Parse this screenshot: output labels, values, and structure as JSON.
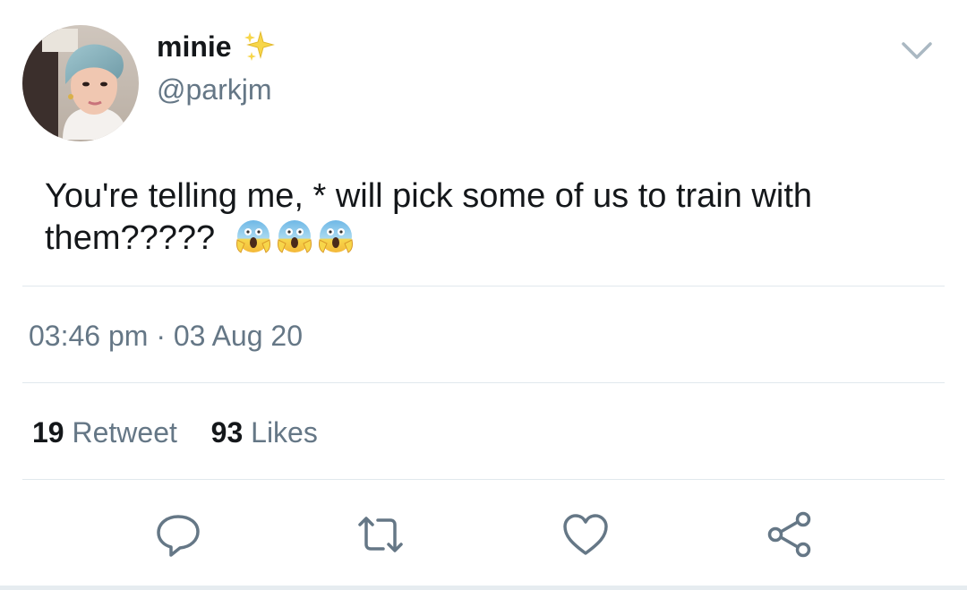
{
  "author": {
    "display_name": "minie",
    "handle": "@parkjm",
    "name_badge_icon": "sparkles-icon"
  },
  "tweet": {
    "text": "You're telling me, * will pick some of us to train with them?????",
    "emojis": [
      "face-screaming-in-fear-emoji",
      "face-screaming-in-fear-emoji",
      "face-screaming-in-fear-emoji"
    ]
  },
  "meta": {
    "time": "03:46 pm",
    "separator": "·",
    "date": "03 Aug 20"
  },
  "stats": {
    "retweet_count": "19",
    "retweet_label": "Retweet",
    "like_count": "93",
    "like_label": "Likes"
  },
  "actions": [
    "reply-icon",
    "retweet-icon",
    "like-icon",
    "share-icon"
  ],
  "colors": {
    "primary_text": "#14171a",
    "secondary_text": "#657786",
    "divider": "#e1e8ed",
    "icon": "#657786"
  }
}
